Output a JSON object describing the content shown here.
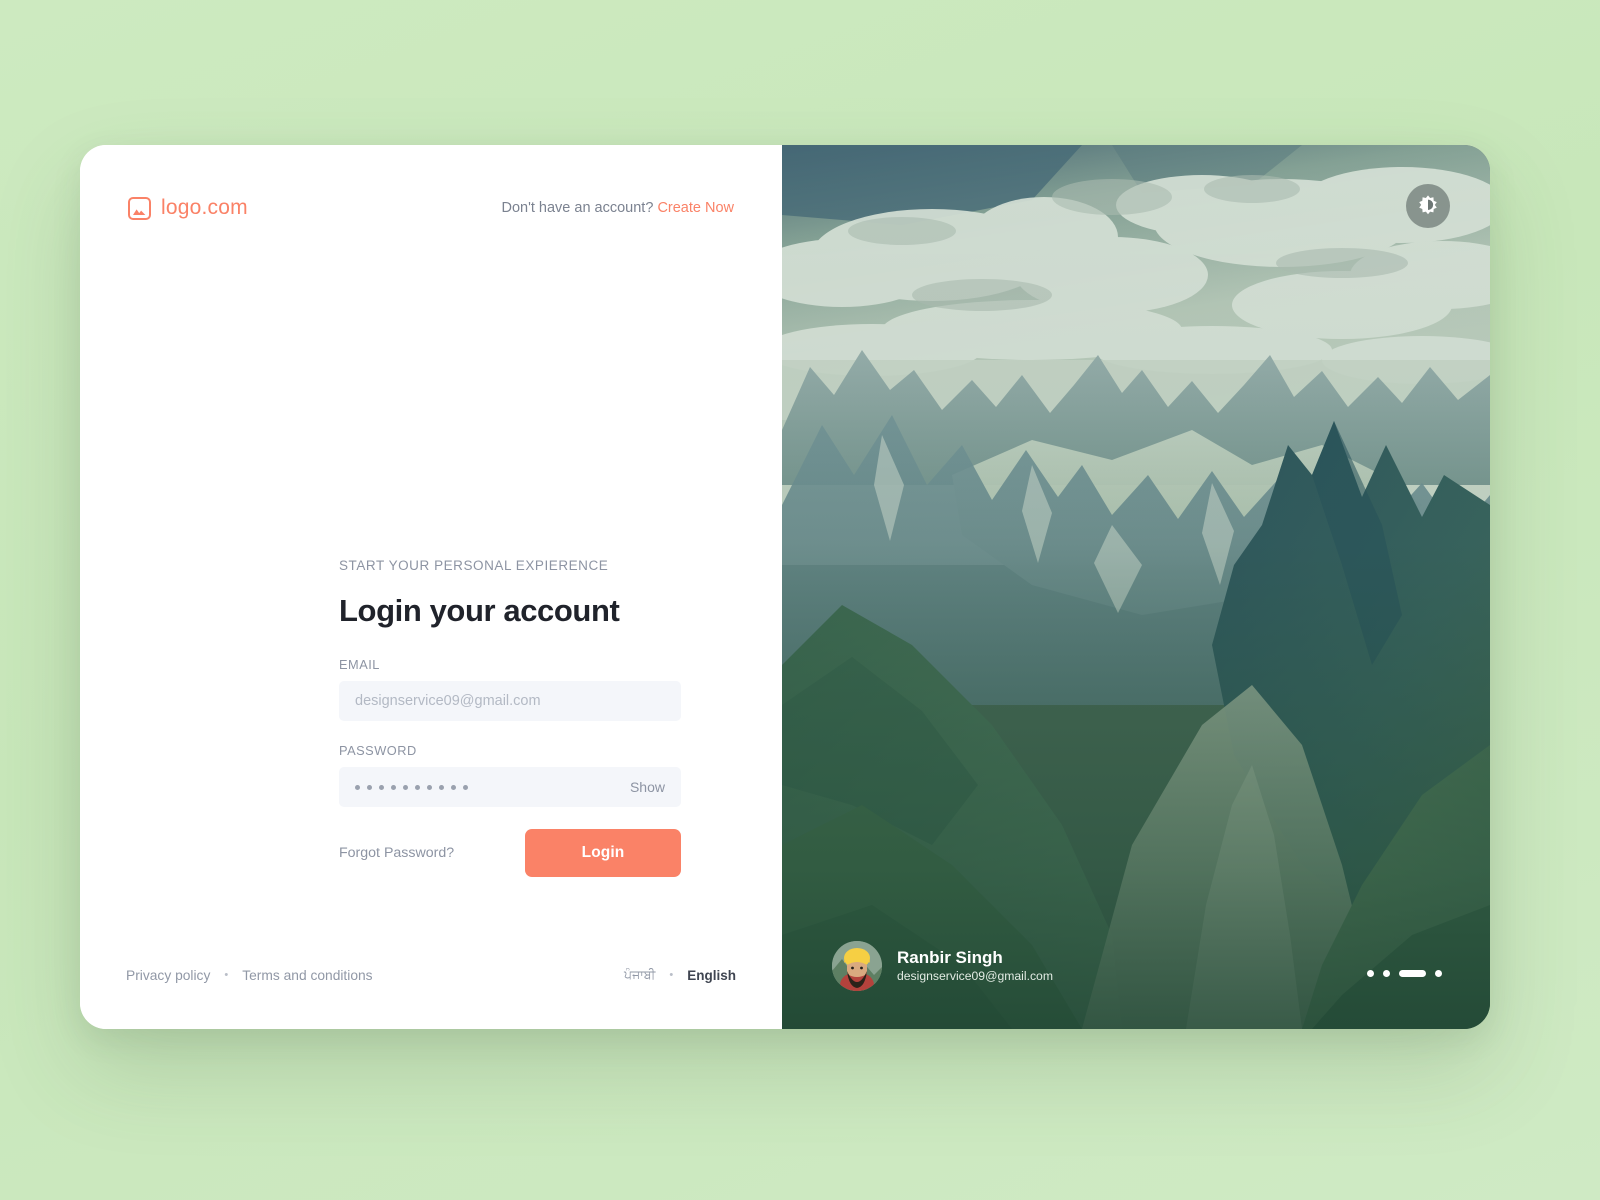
{
  "brand": {
    "name": "logo.com",
    "icon": "image-icon",
    "color": "#fa8267"
  },
  "header": {
    "account_prompt": "Don't have an account?",
    "create_link": "Create Now"
  },
  "form": {
    "eyebrow": "START YOUR PERSONAL EXPIERENCE",
    "headline": "Login your account",
    "email_label": "EMAIL",
    "email_value": "designservice09@gmail.com",
    "email_placeholder": "designservice09@gmail.com",
    "password_label": "PASSWORD",
    "password_dot_count": 10,
    "show_toggle": "Show",
    "forgot_link": "Forgot Password?",
    "login_button": "Login"
  },
  "footer": {
    "privacy": "Privacy policy",
    "terms": "Terms and conditions",
    "separator": "•",
    "lang_other": "ਪੰਜਾਬੀ",
    "lang_active": "English"
  },
  "showcase": {
    "theme_toggle_icon": "brightness-icon",
    "profile": {
      "name": "Ranbir Singh",
      "email": "designservice09@gmail.com",
      "avatar": "user-avatar"
    },
    "carousel": {
      "total": 4,
      "active_index": 2
    },
    "image_alt": "mountain-valley-photo"
  },
  "theme": {
    "accent": "#fa8267",
    "page_background": "#c9e7bc",
    "card_background": "#ffffff",
    "input_background": "#f4f6fa",
    "muted_text": "#8d94a3",
    "heading_text": "#20232b"
  }
}
